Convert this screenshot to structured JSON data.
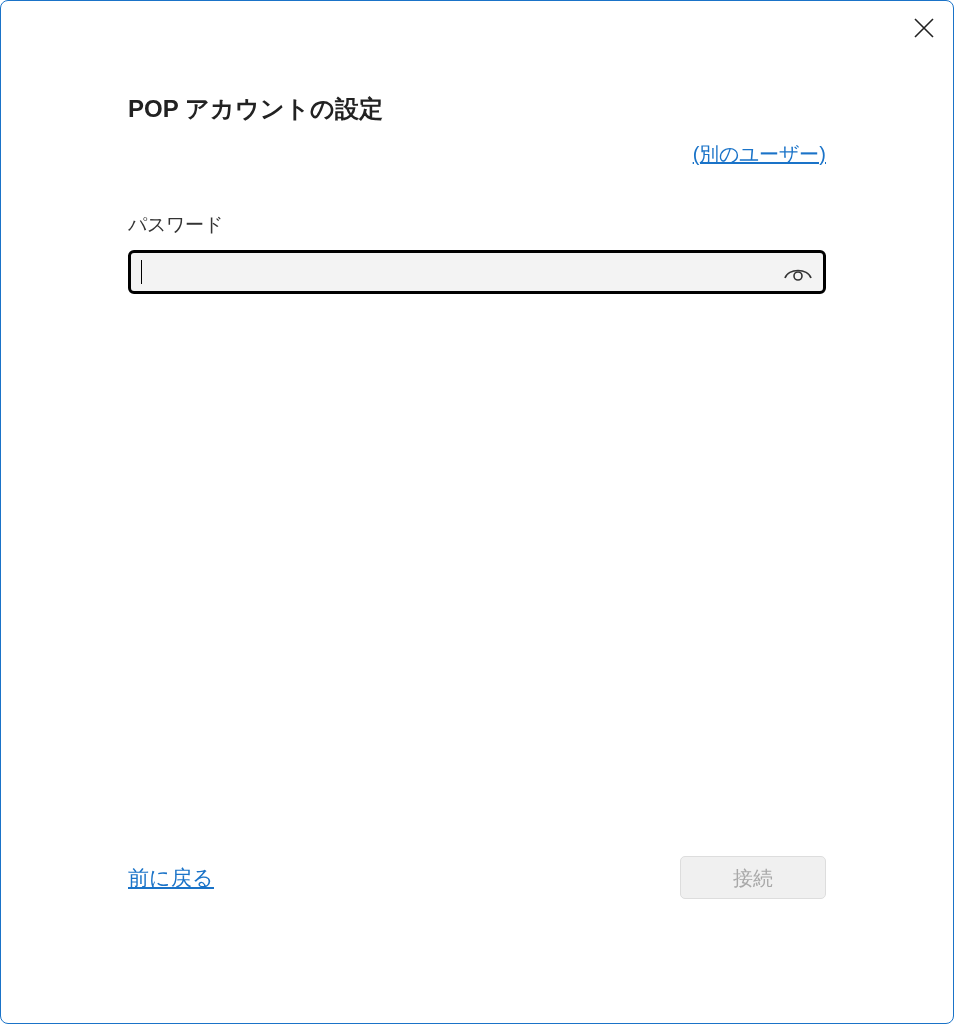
{
  "dialog": {
    "title": "POP アカウントの設定",
    "switch_user_link": "(別のユーザー)"
  },
  "password_field": {
    "label": "パスワード",
    "focused": true
  },
  "footer": {
    "back_link": "前に戻る",
    "connect_button": {
      "label": "接続",
      "disabled": true
    }
  }
}
